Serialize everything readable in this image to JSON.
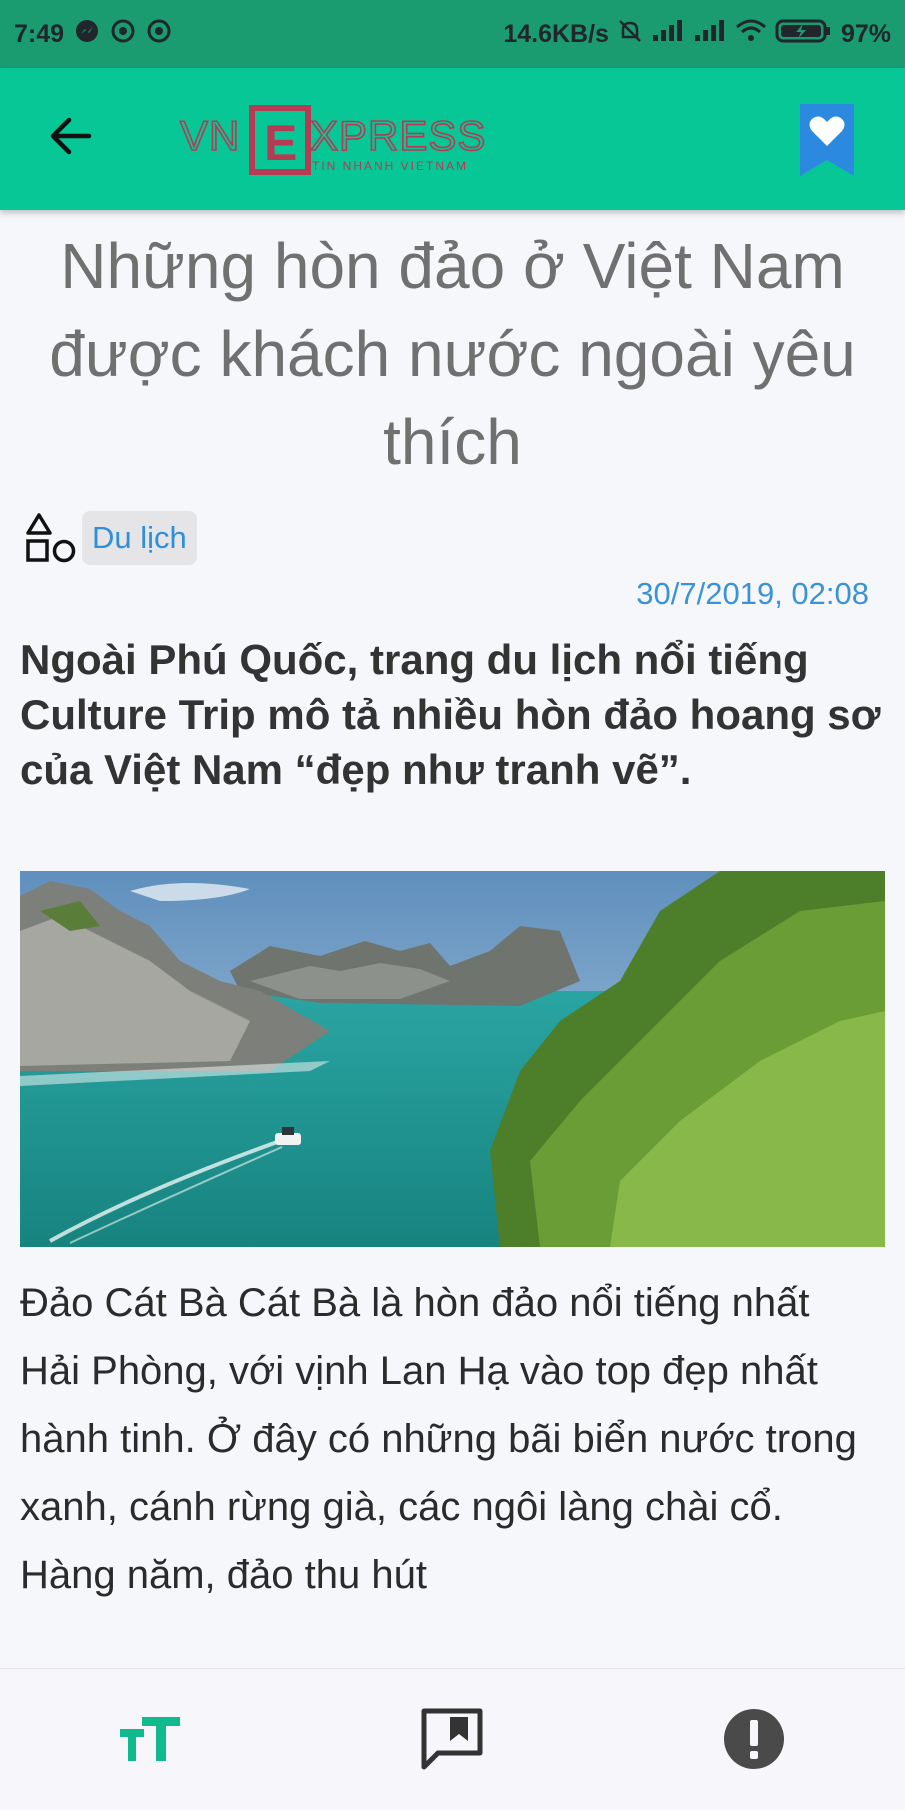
{
  "status_bar": {
    "time": "7:49",
    "network_speed": "14.6KB/s",
    "battery": "97%",
    "icons": [
      "messenger-icon",
      "sync-icon",
      "sync-icon",
      "mute-icon",
      "signal-icon",
      "signal-icon",
      "wifi-icon",
      "battery-charging-icon"
    ]
  },
  "app_bar": {
    "back_icon": "arrow-left-icon",
    "logo_text": "VNEXPRESS",
    "logo_sub": "TIN NHANH VIETNAM",
    "bookmark_icon": "heart-bookmark-icon"
  },
  "article": {
    "title": "Những hòn đảo ở Việt Nam được khách nước ngoài yêu thích",
    "category": "Du lịch",
    "category_icon": "shapes-category-icon",
    "date": "30/7/2019, 02:08",
    "lead": "Ngoài Phú Quốc, trang du lịch nổi tiếng Culture Trip mô tả nhiều hòn đảo hoang sơ của Việt Nam “đẹp như tranh vẽ”.",
    "body": "Đảo Cát Bà  Cát Bà là hòn đảo nổi tiếng nhất Hải Phòng, với vịnh Lan Hạ vào top đẹp nhất hành tinh. Ở đây có những bãi biển nước trong xanh, cánh rừng già, các ngôi làng chài cổ. Hàng năm, đảo thu hút"
  },
  "bottom_bar": {
    "icons": [
      "text-size-icon",
      "comment-icon",
      "report-icon"
    ]
  },
  "colors": {
    "app_bar": "#07c797",
    "status_bar": "#1b9b70",
    "accent_blue": "#2f8fd8",
    "logo_red": "#c8102e"
  }
}
